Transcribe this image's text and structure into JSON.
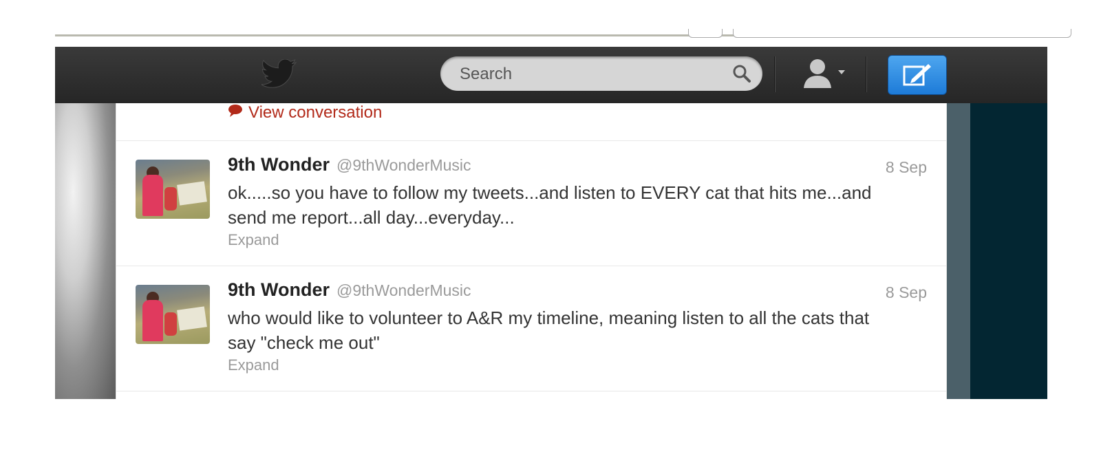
{
  "header": {
    "search_placeholder": "Search"
  },
  "conversation_link": "View conversation",
  "tweets": [
    {
      "name": "9th Wonder",
      "handle": "@9thWonderMusic",
      "time": "8 Sep",
      "text": "ok.....so you have to follow my tweets...and listen to EVERY cat that hits me...and send me report...all day...everyday...",
      "expand": "Expand"
    },
    {
      "name": "9th Wonder",
      "handle": "@9thWonderMusic",
      "time": "8 Sep",
      "text": "who would like to volunteer to A&R my timeline, meaning listen to all the cats that say \"check me out\"",
      "expand": "Expand"
    }
  ],
  "colors": {
    "topbar": "#2e2e2e",
    "compose_button": "#2a8be4",
    "link_red": "#b22a1a",
    "sidebar_dark": "#032632"
  },
  "icons": [
    "twitter-bird-icon",
    "search-icon",
    "user-icon",
    "compose-icon",
    "speech-bubble-icon"
  ]
}
